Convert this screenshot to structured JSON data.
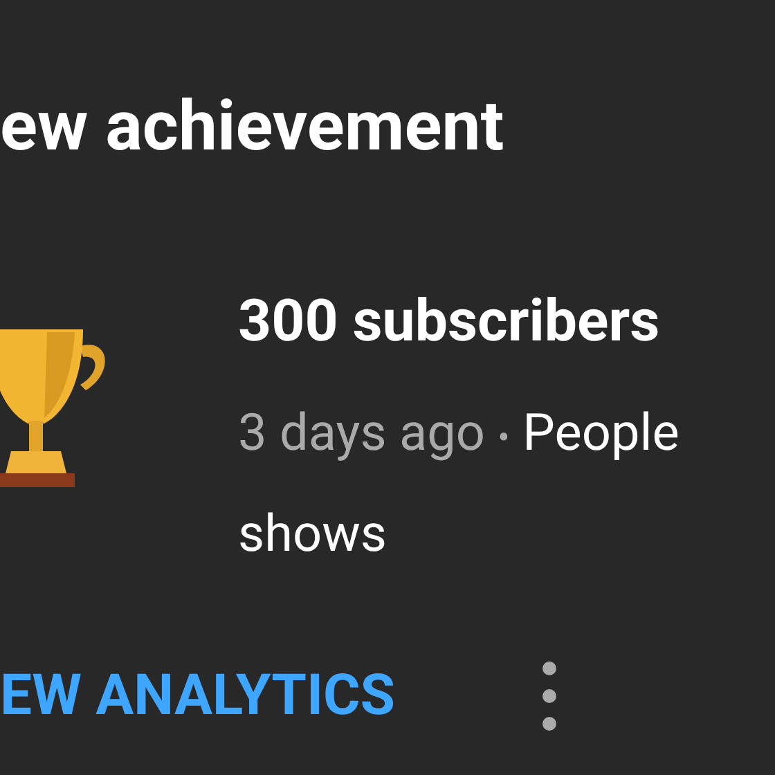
{
  "card": {
    "title": "ew achievement",
    "achievement": {
      "name": "300 subscribers",
      "time": "3 days ago",
      "separator": "•",
      "description": "People shows"
    },
    "action": {
      "label": "EW ANALYTICS"
    }
  }
}
